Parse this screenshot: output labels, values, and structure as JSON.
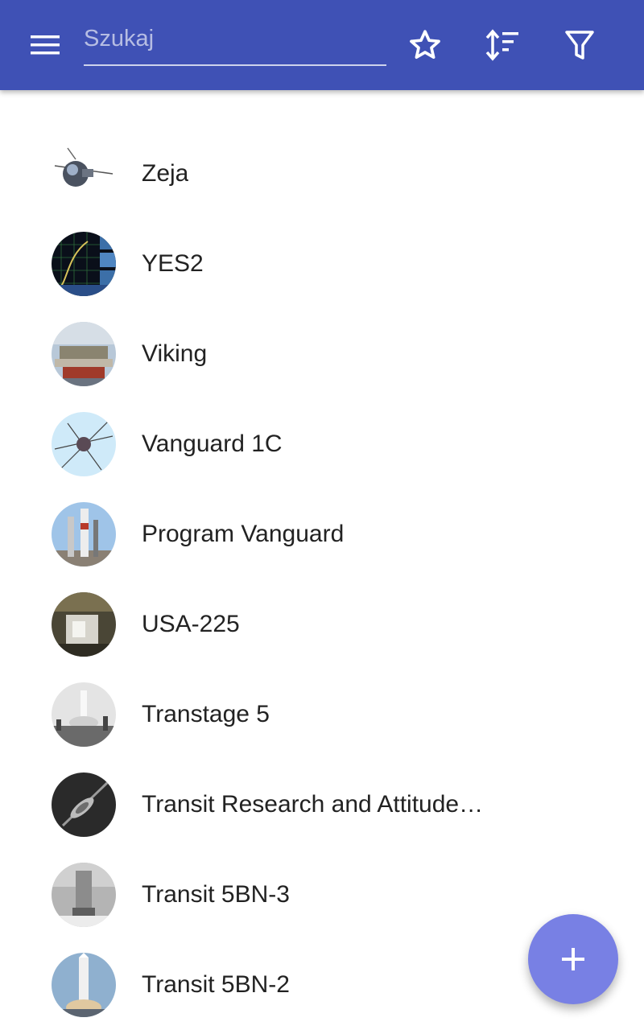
{
  "appbar": {
    "color": "#3f51b5",
    "menu_icon": "menu-icon",
    "search": {
      "placeholder": "Szukaj",
      "value": ""
    },
    "actions": [
      "star-icon",
      "sort-icon",
      "filter-icon"
    ]
  },
  "items": [
    {
      "label": "Zeja",
      "thumb": "satellite"
    },
    {
      "label": "YES2",
      "thumb": "chart"
    },
    {
      "label": "Viking",
      "thumb": "spacecraft"
    },
    {
      "label": "Vanguard 1C",
      "thumb": "sphere-antennas"
    },
    {
      "label": "Program Vanguard",
      "thumb": "rocket-pad"
    },
    {
      "label": "USA-225",
      "thumb": "lab-equipment"
    },
    {
      "label": "Transtage 5",
      "thumb": "launch-grayscale"
    },
    {
      "label": "Transit Research and Attitude…",
      "thumb": "satellite-dark"
    },
    {
      "label": "Transit 5BN-3",
      "thumb": "rocket-blur"
    },
    {
      "label": "Transit 5BN-2",
      "thumb": "rocket-launch"
    }
  ],
  "fab": {
    "icon": "plus-icon",
    "color": "#7880e4"
  }
}
